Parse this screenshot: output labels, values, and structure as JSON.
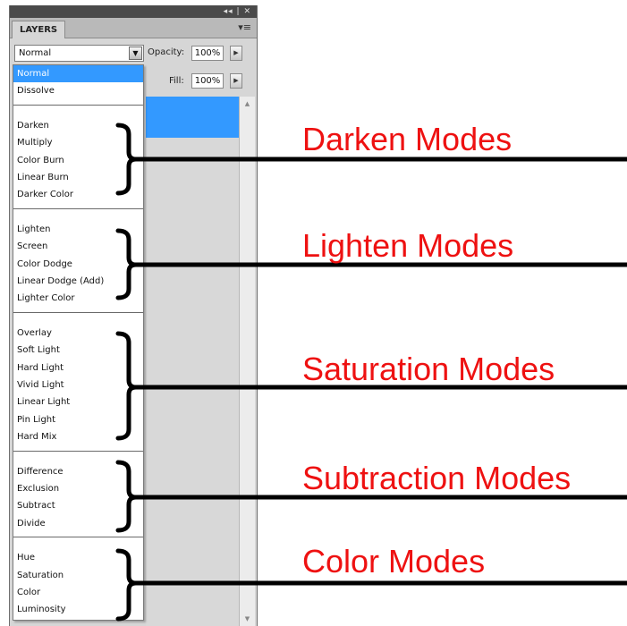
{
  "panel": {
    "window_controls": "◂◂ | ✕",
    "tab_label": "LAYERS",
    "menu_icon": "panel-menu-icon",
    "blend_mode": "Normal",
    "opacity_label": "Opacity:",
    "opacity_value": "100%",
    "fill_label": "Fill:",
    "fill_value": "100%"
  },
  "blend_modes": {
    "selected": "Normal",
    "groups": [
      [
        "Normal",
        "Dissolve"
      ],
      [
        "Darken",
        "Multiply",
        "Color Burn",
        "Linear Burn",
        "Darker Color"
      ],
      [
        "Lighten",
        "Screen",
        "Color Dodge",
        "Linear Dodge (Add)",
        "Lighter Color"
      ],
      [
        "Overlay",
        "Soft Light",
        "Hard Light",
        "Vivid Light",
        "Linear Light",
        "Pin Light",
        "Hard Mix"
      ],
      [
        "Difference",
        "Exclusion",
        "Subtract",
        "Divide"
      ],
      [
        "Hue",
        "Saturation",
        "Color",
        "Luminosity"
      ]
    ]
  },
  "annotations": {
    "darken": "Darken Modes",
    "lighten": "Lighten Modes",
    "saturation": "Saturation Modes",
    "subtraction": "Subtraction Modes",
    "color": "Color Modes"
  },
  "colors": {
    "selection": "#3399ff",
    "annotation_text": "#ee1111",
    "panel_bg": "#d6d6d6"
  }
}
